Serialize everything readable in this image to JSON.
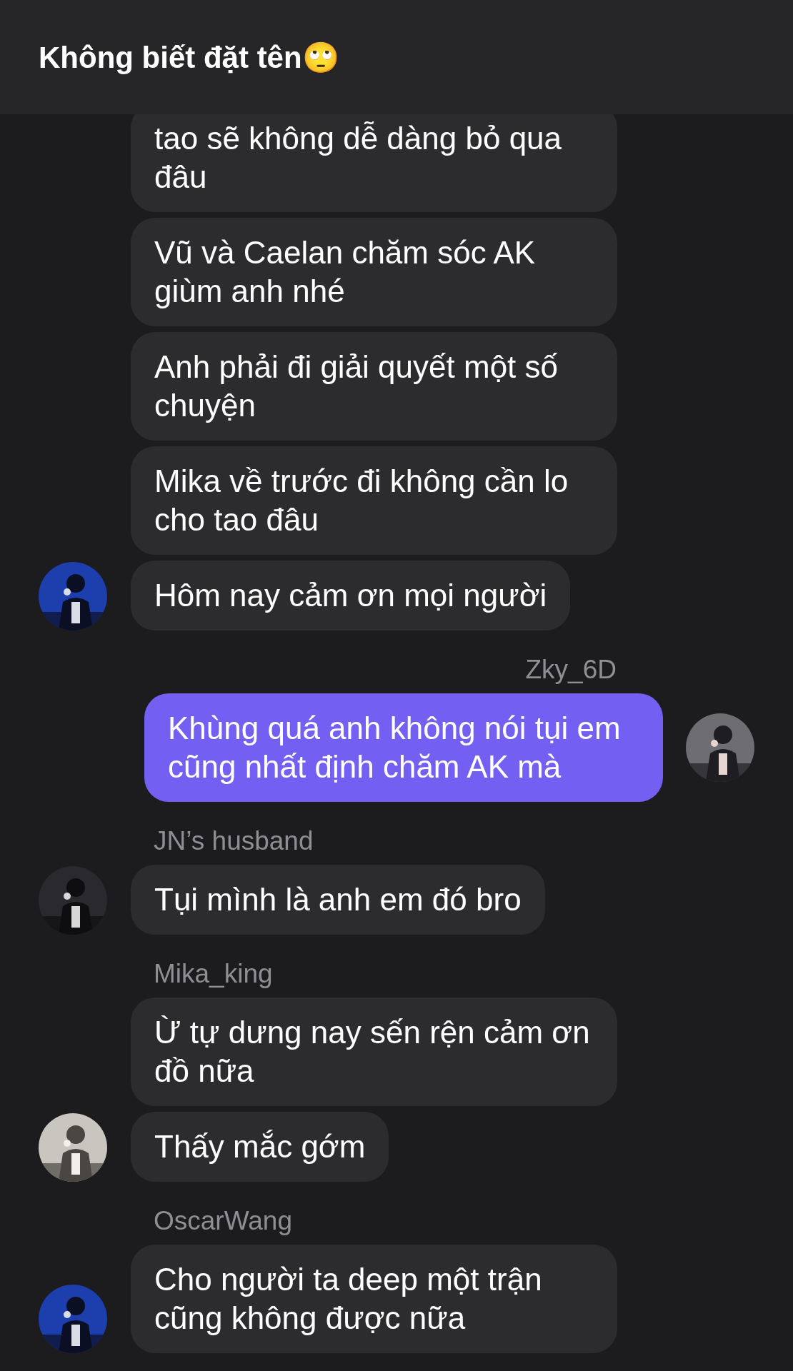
{
  "header": {
    "title": "Không biết đặt tên🙄"
  },
  "groups": [
    {
      "kind": "incoming",
      "avatar": {
        "kind": "picture"
      },
      "messages": [
        "tao sẽ không dễ dàng bỏ qua đâu",
        "Vũ và Caelan chăm sóc AK giùm anh nhé",
        "Anh phải đi giải quyết một số chuyện",
        "Mika về trước đi không cần lo cho tao đâu",
        "Hôm nay cảm ơn mọi người"
      ]
    },
    {
      "kind": "outgoing",
      "sender": "Zky_6D",
      "avatar": {
        "kind": "picture"
      },
      "messages": [
        "Khùng quá anh không nói tụi em cũng nhất định chăm AK mà"
      ]
    },
    {
      "kind": "incoming",
      "sender": "JN’s husband",
      "avatar": {
        "kind": "picture"
      },
      "messages": [
        "Tụi mình là anh em đó bro"
      ]
    },
    {
      "kind": "incoming",
      "sender": "Mika_king",
      "avatar": {
        "kind": "picture"
      },
      "messages": [
        "Ừ tự dưng nay sến rện cảm ơn đồ nữa",
        "Thấy mắc gớm"
      ]
    },
    {
      "kind": "incoming",
      "sender": "OscarWang",
      "avatar": {
        "kind": "picture"
      },
      "messages": [
        "Cho người ta deep một trận cũng không được nữa"
      ]
    }
  ]
}
